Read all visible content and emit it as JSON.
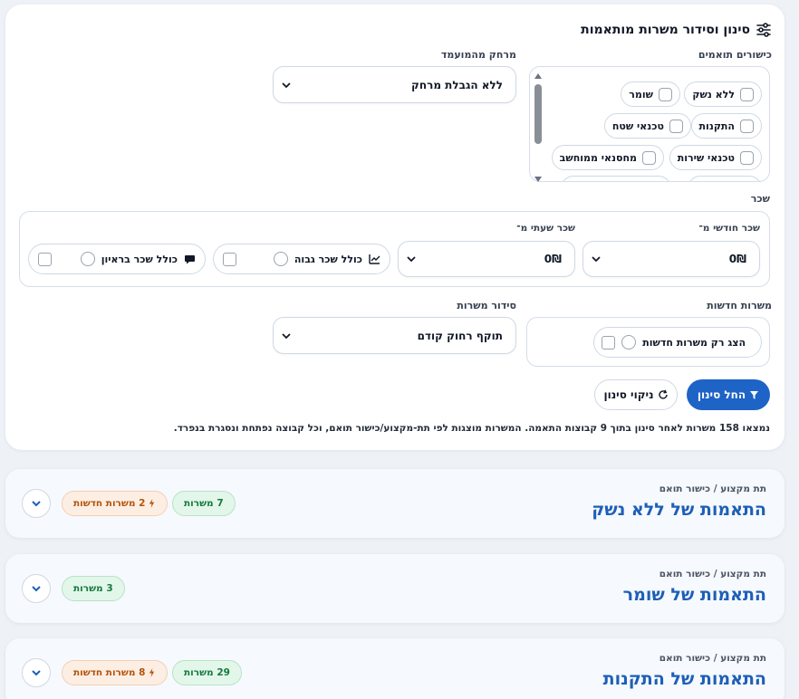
{
  "filters": {
    "title": "סינון וסידור משרות מותאמות",
    "skills_label": "כישורים תואמים",
    "skills": [
      {
        "label": "ללא נשק"
      },
      {
        "label": "שומר"
      },
      {
        "label": "התקנות"
      },
      {
        "label": "טכנאי שטח"
      },
      {
        "label": "טכנאי שירות"
      },
      {
        "label": "מחסנאי ממוחשב"
      }
    ],
    "distance_label": "מרחק מהמועמד",
    "distance_value": "ללא הגבלת מרחק",
    "salary_label": "שכר",
    "salary_monthly_label": "שכר חודשי מ־",
    "salary_monthly_value": "0₪",
    "salary_hourly_label": "שכר שעתי מ־",
    "salary_hourly_value": "0₪",
    "high_salary_label": "כולל שכר גבוה",
    "interview_salary_label": "כולל שכר בראיון",
    "new_jobs_label": "משרות חדשות",
    "new_jobs_only_label": "הצג רק משרות חדשות",
    "sort_label": "סידור משרות",
    "sort_value": "תוקף רחוק קודם",
    "apply_label": "החל סינון",
    "clear_label": "ניקוי סינון",
    "summary": "נמצאו 158 משרות לאחר סינון בתוך 9 קבוצות התאמה. המשרות מוצגות לפי תת-מקצוע/כישור תואם, וכל קבוצה נפתחת ונסגרת בנפרד."
  },
  "groups": [
    {
      "subtitle": "תת מקצוע / כישור תואם",
      "title": "התאמות של ללא נשק",
      "jobs": "7 משרות",
      "new_jobs": "2 משרות חדשות"
    },
    {
      "subtitle": "תת מקצוע / כישור תואם",
      "title": "התאמות של שומר",
      "jobs": "3 משרות",
      "new_jobs": ""
    },
    {
      "subtitle": "תת מקצוע / כישור תואם",
      "title": "התאמות של התקנות",
      "jobs": "29 משרות",
      "new_jobs": "8 משרות חדשות"
    }
  ],
  "colors": {
    "primary": "#1e63c6",
    "title_blue": "#1d5fb8",
    "green": "#157a3c",
    "orange": "#b4530b"
  }
}
